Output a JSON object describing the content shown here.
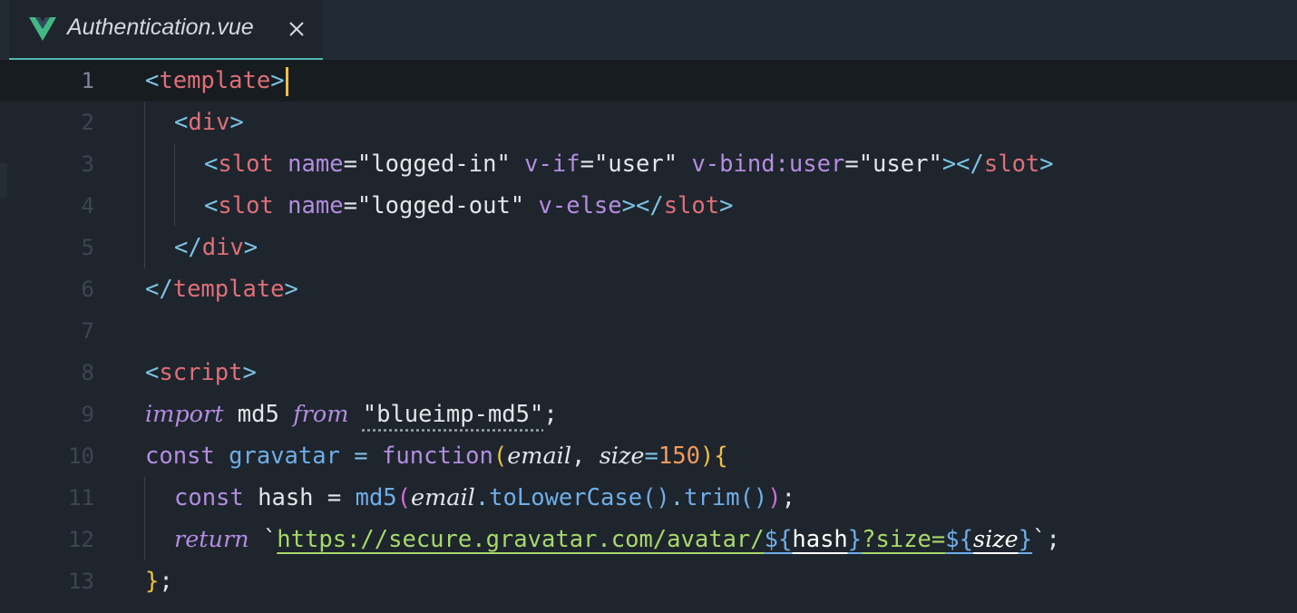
{
  "tab": {
    "title": "Authentication.vue",
    "close_glyph": "✕"
  },
  "icons": {
    "file_type": "vue-icon",
    "close": "close-icon"
  },
  "colors": {
    "background": "#1e252d",
    "tab_accent": "#4fb8b0",
    "vue_green": "#41b883",
    "cursor": "#f0c040",
    "tag": "#e06e78",
    "punctuation": "#7cc3e4",
    "keyword": "#b48ce0",
    "function": "#6faee8",
    "number": "#f39a5c",
    "url_string": "#a8d86a"
  },
  "editor": {
    "current_line": 1,
    "lines": [
      {
        "num": "1",
        "tokens": [
          "<",
          "template",
          ">"
        ]
      },
      {
        "num": "2",
        "tokens": [
          "<",
          "div",
          ">"
        ]
      },
      {
        "num": "3",
        "tokens": [
          "<",
          "slot",
          " ",
          "name",
          "=",
          "\"logged-in\"",
          " ",
          "v-if",
          "=",
          "\"user\"",
          " ",
          "v-bind:user",
          "=",
          "\"user\"",
          "></",
          "slot",
          ">"
        ]
      },
      {
        "num": "4",
        "tokens": [
          "<",
          "slot",
          " ",
          "name",
          "=",
          "\"logged-out\"",
          " ",
          "v-else",
          "></",
          "slot",
          ">"
        ]
      },
      {
        "num": "5",
        "tokens": [
          "</",
          "div",
          ">"
        ]
      },
      {
        "num": "6",
        "tokens": [
          "</",
          "template",
          ">"
        ]
      },
      {
        "num": "7",
        "tokens": []
      },
      {
        "num": "8",
        "tokens": [
          "<",
          "script",
          ">"
        ]
      },
      {
        "num": "9",
        "tokens": [
          "import",
          " md5 ",
          "from",
          " ",
          "\"blueimp-md5\"",
          ";"
        ]
      },
      {
        "num": "10",
        "tokens": [
          "const",
          " ",
          "gravatar",
          " = ",
          "function",
          "(",
          "email",
          ", ",
          "size",
          "=",
          "150",
          ")",
          "{"
        ]
      },
      {
        "num": "11",
        "tokens": [
          "const",
          " hash = ",
          "md5",
          "(",
          "email",
          ".",
          "toLowerCase",
          "()",
          ".",
          "trim",
          "()",
          ")",
          ";"
        ]
      },
      {
        "num": "12",
        "tokens": [
          "return",
          " ",
          "`",
          "https://secure.gravatar.com/avatar/",
          "${",
          "hash",
          "}",
          "?size=",
          "${",
          "size",
          "}",
          "`",
          ";"
        ]
      },
      {
        "num": "13",
        "tokens": [
          "}",
          ";"
        ]
      }
    ]
  }
}
